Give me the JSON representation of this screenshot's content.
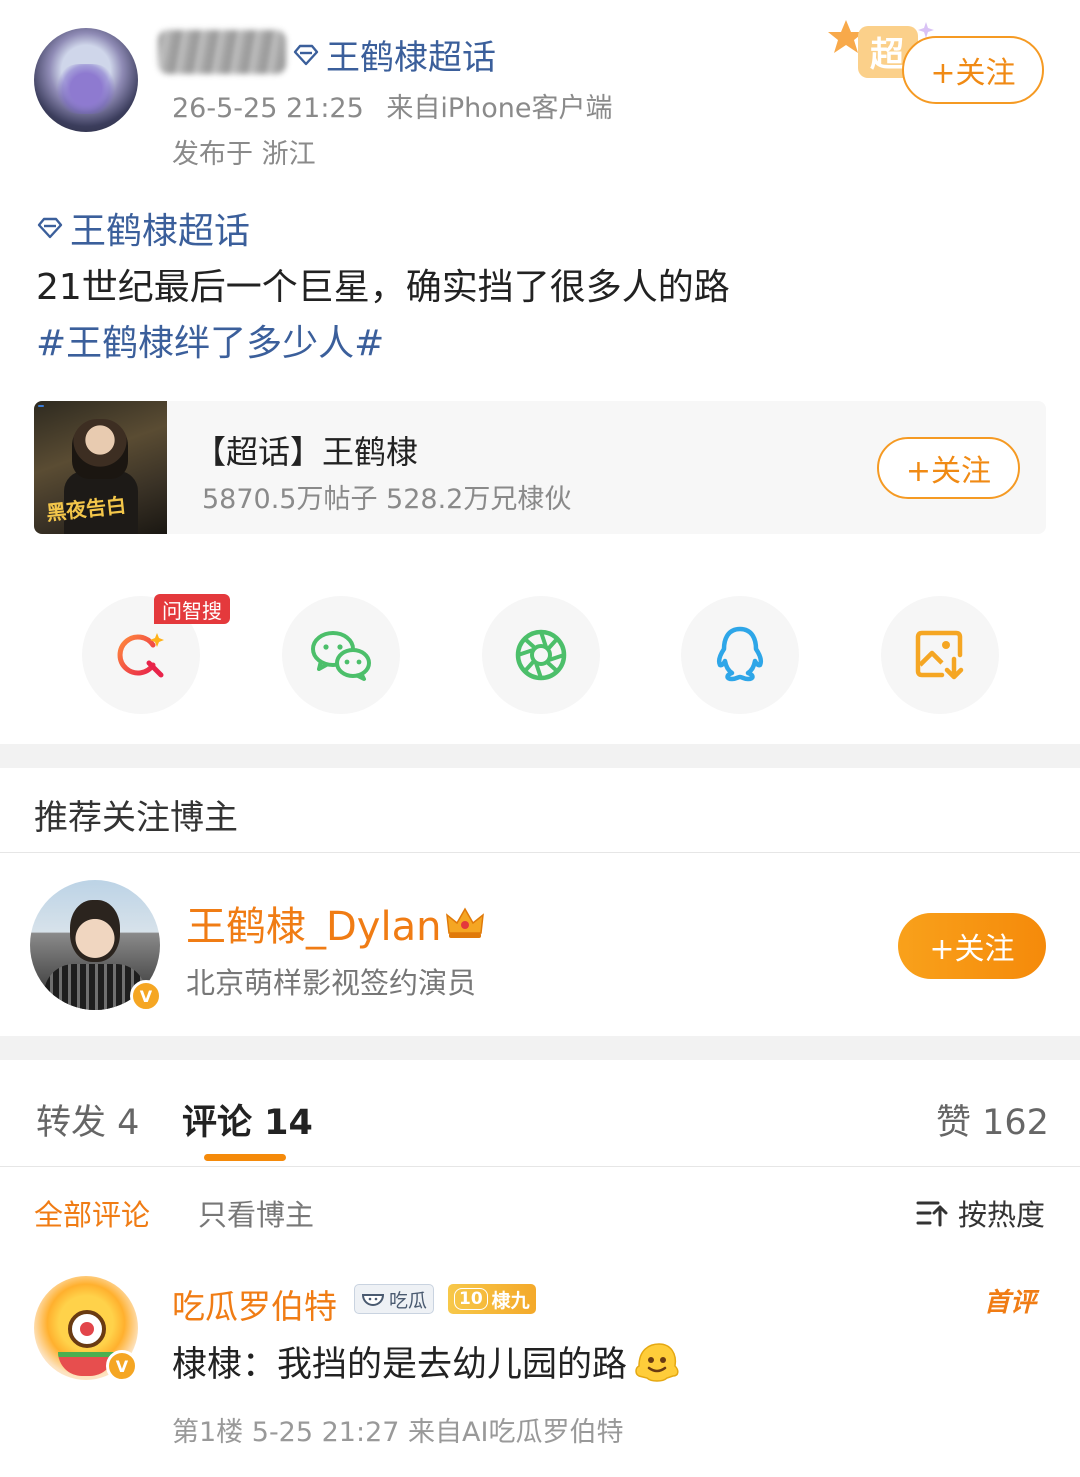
{
  "post": {
    "super_topic_link": "王鹤棣超话",
    "time": "26-5-25 21:25",
    "source": "来自iPhone客户端",
    "location": "发布于 浙江",
    "follow_label": "+关注",
    "super_badge": "超",
    "topic_tag": "王鹤棣超话",
    "text": "21世纪最后一个巨星，确实挡了很多人的路",
    "hashtag": "#王鹤棣绊了多少人#"
  },
  "topic_card": {
    "name": "【超话】王鹤棣",
    "stats": "5870.5万帖子  528.2万兄棣伙",
    "follow_label": "+关注"
  },
  "share": {
    "ai_badge": "问智搜",
    "items": [
      "ai-search",
      "wechat",
      "moments",
      "qq",
      "save-image"
    ]
  },
  "recommend": {
    "title": "推荐关注博主",
    "name": "王鹤棣_Dylan",
    "desc": "北京萌样影视签约演员",
    "follow_label": "+关注",
    "verified_mark": "V"
  },
  "tabs": {
    "repost": "转发 4",
    "comment": "评论 14",
    "like": "赞 162"
  },
  "filters": {
    "all": "全部评论",
    "blogger_only": "只看博主",
    "sort": "按热度"
  },
  "comment": {
    "user": "吃瓜罗伯特",
    "chip1": "吃瓜",
    "chip2_level": "10",
    "chip2_text": "棣九",
    "first_badge": "首评",
    "text": "棣棣：我挡的是去幼儿园的路",
    "meta": "第1楼 5-25 21:27 来自AI吃瓜罗伯特"
  },
  "colors": {
    "accent": "#f58a0a",
    "link": "#3b5f9b",
    "ai_red": "#e4393c"
  }
}
